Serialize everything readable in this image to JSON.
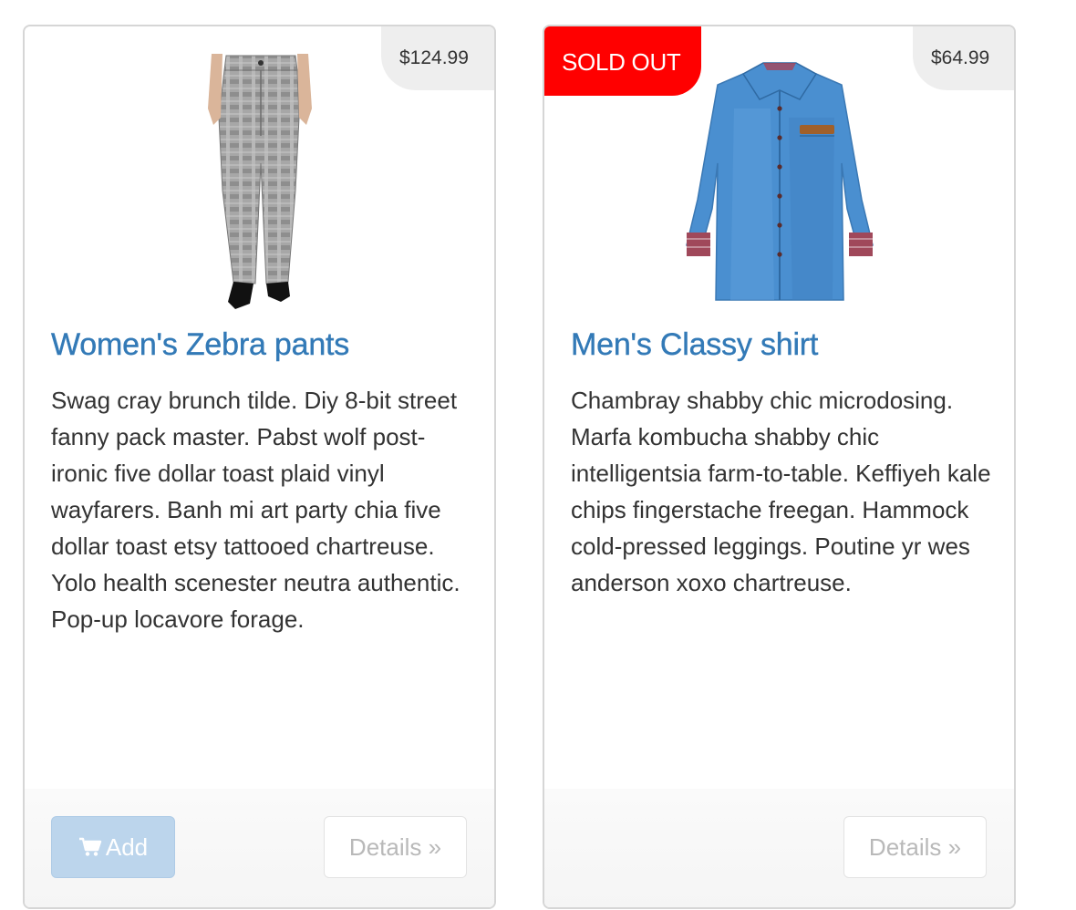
{
  "products": [
    {
      "price": "$124.99",
      "image_icon": "pants-image",
      "title": "Women's Zebra pants",
      "description": "Swag cray brunch tilde. Diy 8-bit street fanny pack master. Pabst wolf post-ironic five dollar toast plaid vinyl wayfarers. Banh mi art party chia five dollar toast etsy tattooed chartreuse. Yolo health scenester neutra authentic. Pop-up locavore forage.",
      "add_label": "Add",
      "add_icon": "shopping-cart-icon",
      "details_label": "Details »"
    },
    {
      "badge": "SOLD OUT",
      "price": "$64.99",
      "image_icon": "shirt-image",
      "title": "Men's Classy shirt",
      "description": "Chambray shabby chic microdosing. Marfa kombucha shabby chic intelligentsia farm-to-table. Keffiyeh kale chips fingerstache freegan. Hammock cold-pressed leggings. Poutine yr wes anderson xoxo chartreuse.",
      "details_label": "Details »"
    }
  ],
  "colors": {
    "title": "#337ab7",
    "sold_out": "#ff0000",
    "add_button": "#bcd5ec",
    "price_tag": "#eeeeee"
  }
}
